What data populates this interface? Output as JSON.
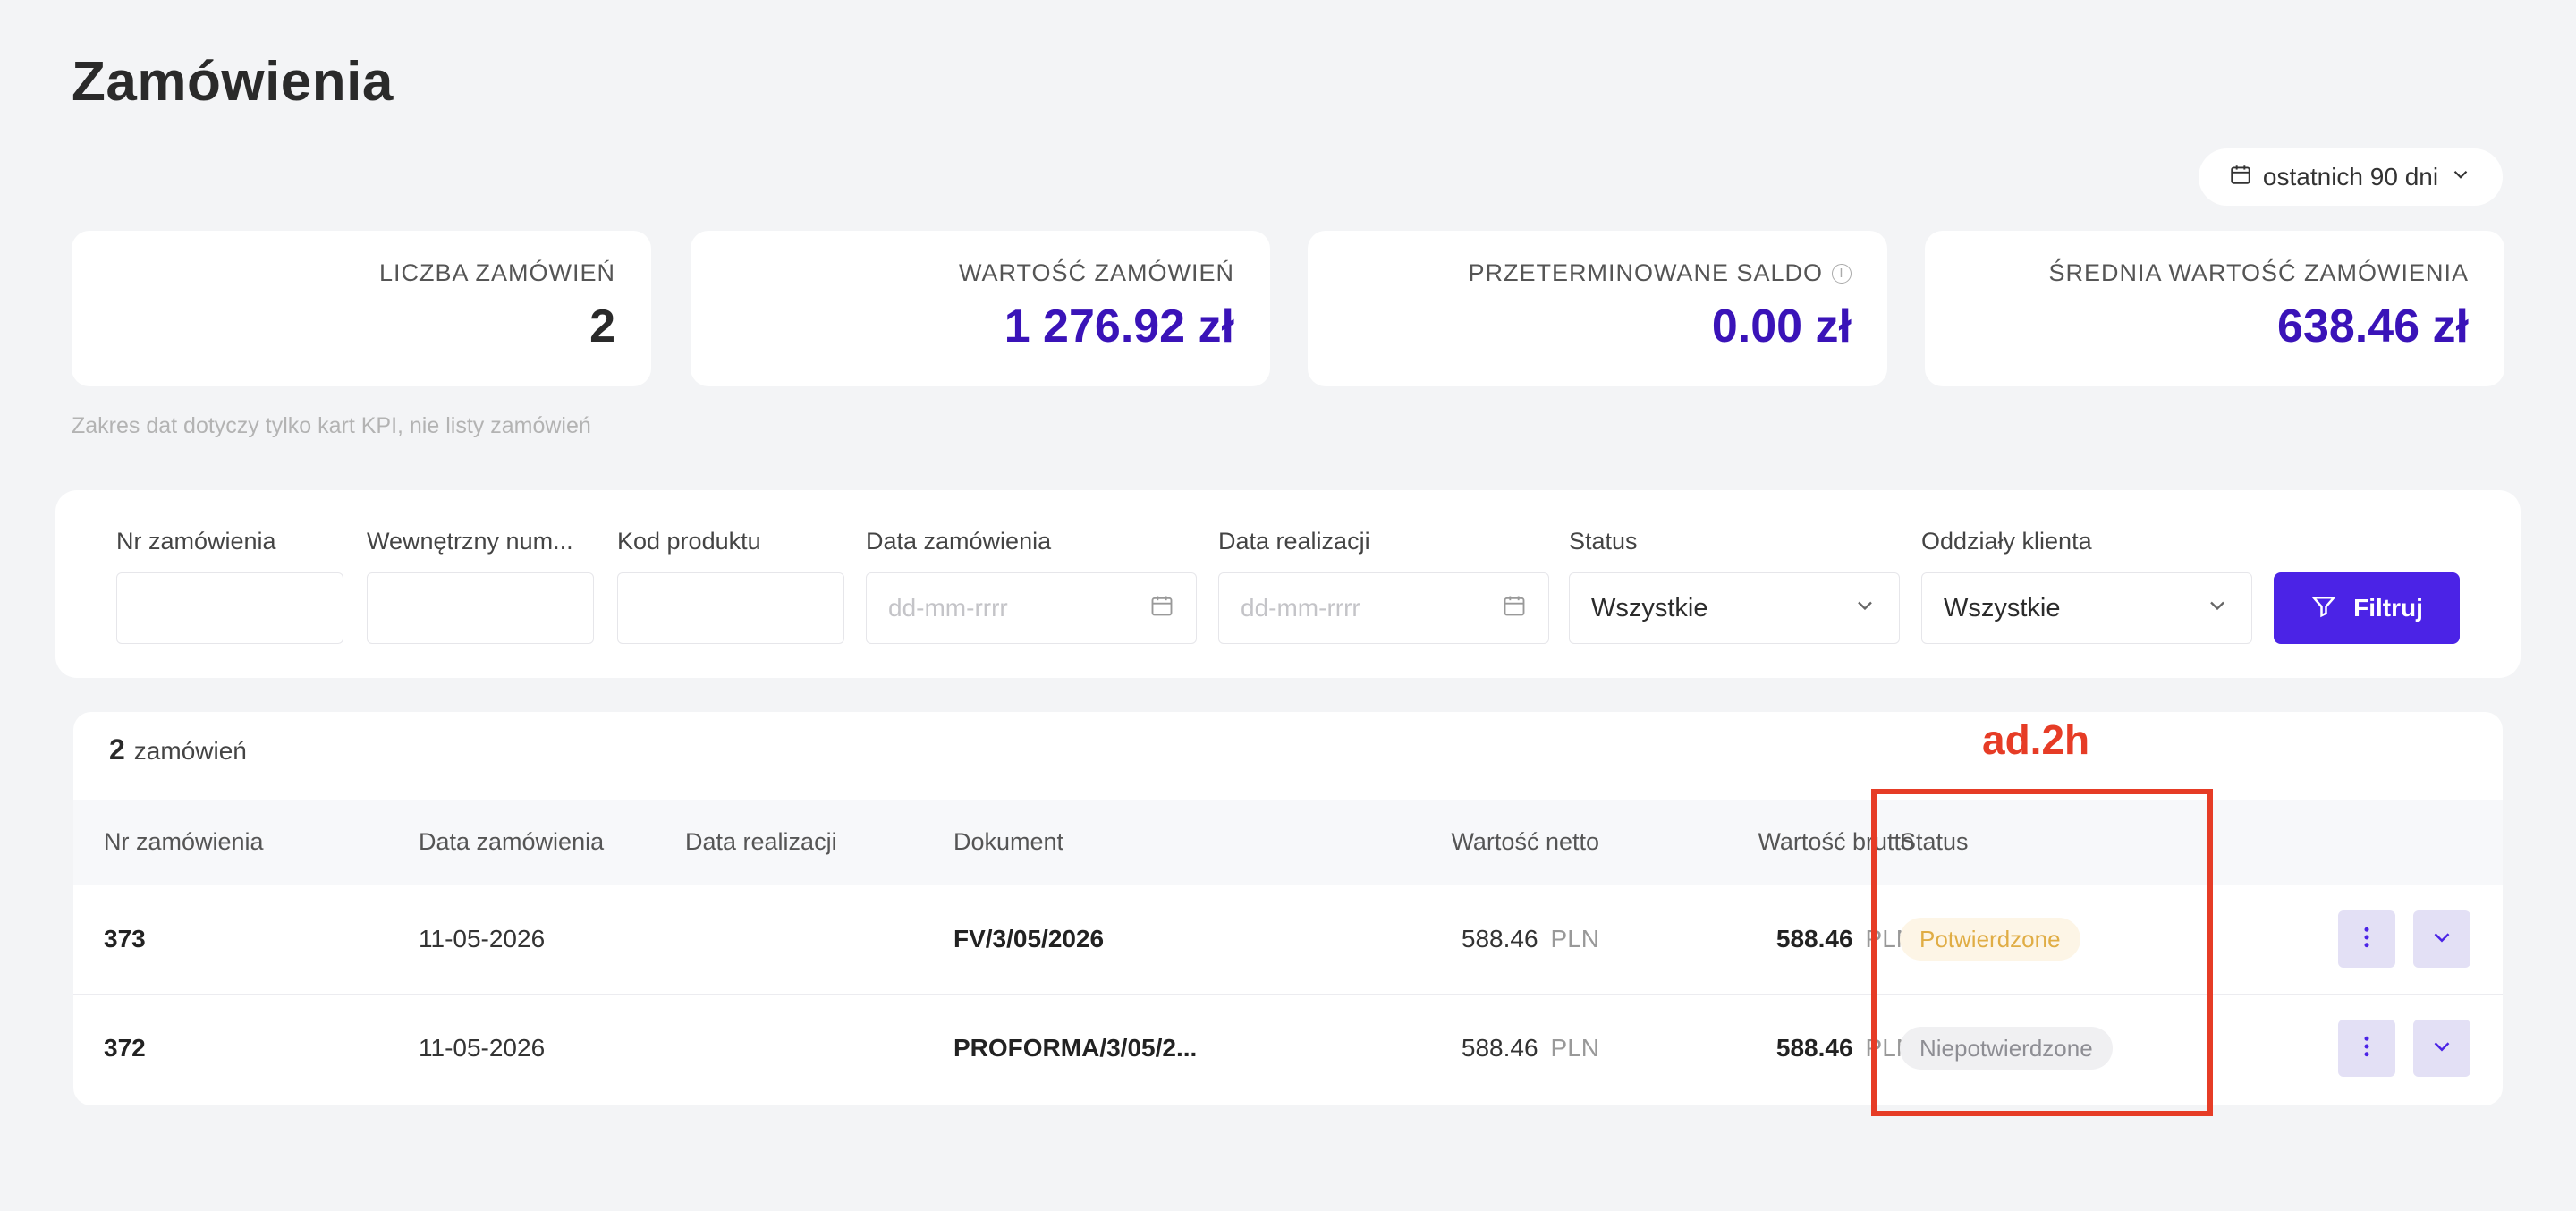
{
  "page_title": "Zamówienia",
  "date_range": {
    "label": "ostatnich 90 dni"
  },
  "kpis": [
    {
      "label": "LICZBA ZAMÓWIEŃ",
      "value": "2"
    },
    {
      "label": "WARTOŚĆ ZAMÓWIEŃ",
      "value": "1 276.92 zł"
    },
    {
      "label": "PRZETERMINOWANE SALDO",
      "value": "0.00 zł"
    },
    {
      "label": "ŚREDNIA WARTOŚĆ ZAMÓWIENIA",
      "value": "638.46 zł"
    }
  ],
  "kpi_note": "Zakres dat dotyczy tylko kart KPI, nie listy zamówień",
  "filters": {
    "order_number": {
      "label": "Nr zamówienia",
      "value": ""
    },
    "internal_number": {
      "label": "Wewnętrzny num...",
      "value": ""
    },
    "product_code": {
      "label": "Kod produktu",
      "value": ""
    },
    "order_date": {
      "label": "Data zamówienia",
      "placeholder": "dd-mm-rrrr"
    },
    "realization_date": {
      "label": "Data realizacji",
      "placeholder": "dd-mm-rrrr"
    },
    "status": {
      "label": "Status",
      "value": "Wszystkie"
    },
    "branches": {
      "label": "Oddziały klienta",
      "value": "Wszystkie"
    },
    "submit_label": "Filtruj"
  },
  "orders": {
    "count": "2",
    "count_label": "zamówień",
    "columns": {
      "number": "Nr zamówienia",
      "order_date": "Data zamówienia",
      "realization_date": "Data realizacji",
      "document": "Dokument",
      "net": "Wartość netto",
      "gross": "Wartość brutto",
      "status": "Status"
    },
    "rows": [
      {
        "number": "373",
        "order_date": "11-05-2026",
        "realization_date": "",
        "document": "FV/3/05/2026",
        "net": "588.46",
        "gross": "588.46",
        "currency": "PLN",
        "status": "Potwierdzone"
      },
      {
        "number": "372",
        "order_date": "11-05-2026",
        "realization_date": "",
        "document": "PROFORMA/3/05/2...",
        "net": "588.46",
        "gross": "588.46",
        "currency": "PLN",
        "status": "Niepotwierdzone"
      }
    ]
  },
  "annotation": {
    "label": "ad.2h"
  },
  "colors": {
    "accent": "#4b23e6",
    "kpi_value": "#3a13b8",
    "annotation": "#e63c26"
  }
}
